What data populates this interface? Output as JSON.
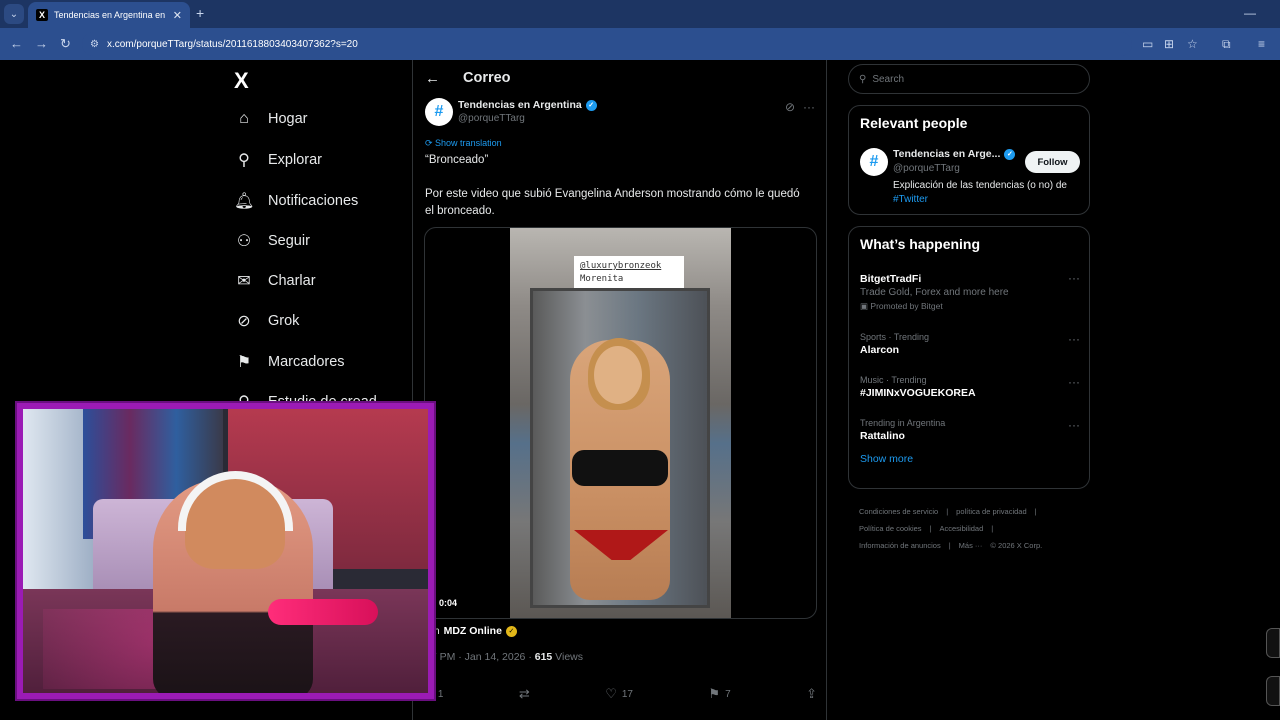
{
  "browser": {
    "tab_title": "Tendencias en Argentina en X:",
    "tab_close": "✕",
    "new_tab": "+",
    "url": "x.com/porqueTTarg/status/2011618803403407362?s=20"
  },
  "nav": {
    "brand": "X",
    "items": [
      {
        "label": "Hogar",
        "icon": "home-icon"
      },
      {
        "label": "Explorar",
        "icon": "search-icon"
      },
      {
        "label": "Notificaciones",
        "icon": "bell-icon"
      },
      {
        "label": "Seguir",
        "icon": "follow-icon"
      },
      {
        "label": "Charlar",
        "icon": "mail-icon"
      },
      {
        "label": "Grok",
        "icon": "grok-icon"
      },
      {
        "label": "Marcadores",
        "icon": "bookmark-icon"
      },
      {
        "label": "Estudio de cread",
        "icon": "creator-studio-icon"
      }
    ]
  },
  "post": {
    "page_title": "Correo",
    "author_name": "Tendencias en Argentina",
    "author_handle": "@porqueTTarg",
    "show_translation": "Show translation",
    "text_line1": "“Bronceado”",
    "text_body": "Por este video que subió Evangelina Anderson mostrando cómo le quedó el bronceado.",
    "video_sticker_line1": "@luxurybronzeok",
    "video_sticker_line2": "Morenita",
    "video_time": "0:04",
    "from_prefix": "om",
    "from_source": "MDZ Online",
    "time_prefix": "57 PM · Jan 14, 2026 · ",
    "views_count": "615",
    "views_label": " Views",
    "replies": "1",
    "likes": "17",
    "bookmarks": "7"
  },
  "sidebar": {
    "search_placeholder": "Search",
    "relevant_title": "Relevant people",
    "relevant_name": "Tendencias en Arge...",
    "relevant_handle": "@porqueTTarg",
    "follow_label": "Follow",
    "relevant_bio": "Explicación de las tendencias (o no) de",
    "relevant_bio_tag": "#Twitter",
    "happening_title": "What’s happening",
    "trends": [
      {
        "context": "",
        "name": "BitgetTradFi",
        "sub": "Trade Gold, Forex and more here",
        "promo": "Promoted by Bitget"
      },
      {
        "context": "Sports · Trending",
        "name": "Alarcon"
      },
      {
        "context": "Music · Trending",
        "name": "#JIMINxVOGUEKOREA"
      },
      {
        "context": "Trending in Argentina",
        "name": "Rattalino"
      }
    ],
    "show_more": "Show more",
    "footer": [
      "Condiciones de servicio",
      "|",
      "política de privacidad",
      "|",
      "Política de cookies",
      "|",
      "Accesibilidad",
      "|",
      "Información de anuncios",
      "|",
      "Más ···",
      "© 2026 X Corp."
    ]
  },
  "colors": {
    "accent": "#1d9bf0",
    "browser_chrome": "#2c4f8f",
    "webcam_border": "#9b1bb5"
  }
}
